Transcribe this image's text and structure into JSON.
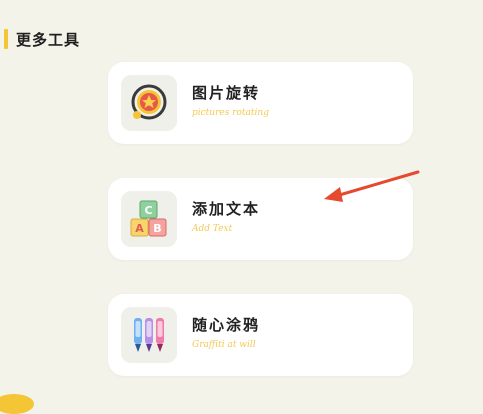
{
  "section": {
    "title": "更多工具"
  },
  "tools": [
    {
      "title": "图片旋转",
      "subtitle": "pictures rotating",
      "icon": "rotate-image-icon"
    },
    {
      "title": "添加文本",
      "subtitle": "Add Text",
      "icon": "abc-blocks-icon"
    },
    {
      "title": "随心涂鸦",
      "subtitle": "Graffiti at will",
      "icon": "markers-icon"
    }
  ],
  "colors": {
    "accent": "#f4c534",
    "subtitle": "#f2c955",
    "arrow": "#e64a2e",
    "background": "#f3f3ea"
  }
}
